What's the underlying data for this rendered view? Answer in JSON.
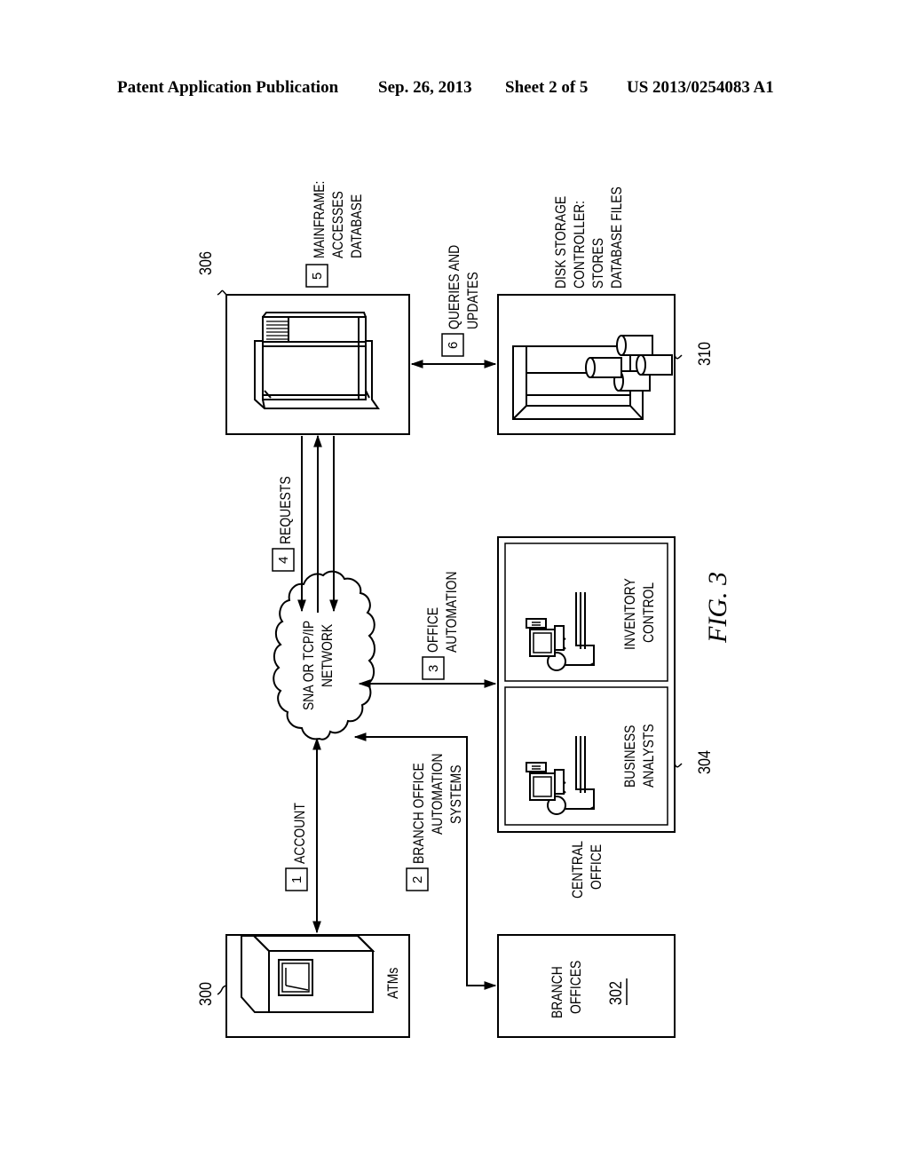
{
  "header": {
    "publication": "Patent Application Publication",
    "date": "Sep. 26, 2013",
    "sheet": "Sheet 2 of 5",
    "patent_number": "US 2013/0254083 A1"
  },
  "figure": {
    "caption": "FIG. 3",
    "nodes": {
      "atms": {
        "ref": "300",
        "label": "ATMs",
        "icon": "atm-machine-icon"
      },
      "branch_offices": {
        "ref": "302",
        "label_lines": [
          "BRANCH",
          "OFFICES"
        ]
      },
      "central_office": {
        "ref": "304",
        "label_lines": [
          "CENTRAL",
          "OFFICE"
        ],
        "panels": [
          {
            "label_lines": [
              "BUSINESS",
              "ANALYSTS"
            ],
            "icon": "person-at-computer-icon"
          },
          {
            "label_lines": [
              "INVENTORY",
              "CONTROL"
            ],
            "icon": "person-at-computer-icon"
          }
        ]
      },
      "mainframe": {
        "ref": "306",
        "icon": "mainframe-computer-icon"
      },
      "disk_storage": {
        "ref": "310",
        "icon": "disk-storage-icon"
      },
      "network": {
        "label_lines": [
          "SNA OR TCP/IP",
          "NETWORK"
        ],
        "icon": "cloud-icon"
      }
    },
    "steps": [
      {
        "number": "1",
        "label_lines": [
          "ACCOUNT"
        ]
      },
      {
        "number": "2",
        "label_lines": [
          "BRANCH OFFICE",
          "AUTOMATION",
          "SYSTEMS"
        ]
      },
      {
        "number": "3",
        "label_lines": [
          "OFFICE",
          "AUTOMATION"
        ]
      },
      {
        "number": "4",
        "label_lines": [
          "REQUESTS"
        ]
      },
      {
        "number": "5",
        "label_lines": [
          "MAINFRAME:",
          "ACCESSES",
          "DATABASE"
        ]
      },
      {
        "number": "6",
        "label_lines": [
          "QUERIES AND",
          "UPDATES"
        ]
      }
    ],
    "disk_storage_caption_lines": [
      "DISK STORAGE",
      "CONTROLLER:",
      "STORES",
      "DATABASE FILES"
    ]
  }
}
